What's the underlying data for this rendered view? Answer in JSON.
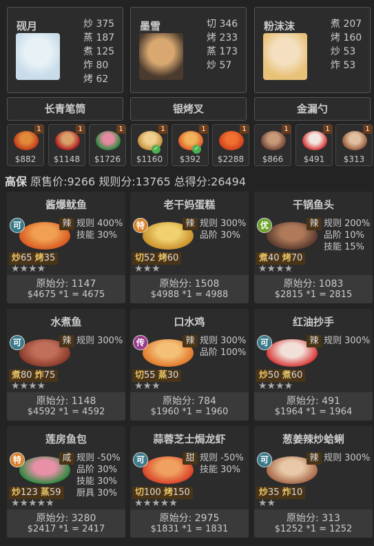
{
  "chefs": [
    {
      "name": "砚月",
      "skills": [
        [
          "炒",
          "375"
        ],
        [
          "蒸",
          "187"
        ],
        [
          "煮",
          "125"
        ],
        [
          "炸",
          "80"
        ],
        [
          "烤",
          "62"
        ]
      ],
      "colors": [
        "#c8dcea",
        "#e8f2f6"
      ]
    },
    {
      "name": "墨雪",
      "skills": [
        [
          "切",
          "346"
        ],
        [
          "烤",
          "233"
        ],
        [
          "蒸",
          "173"
        ],
        [
          "炒",
          "57"
        ]
      ],
      "colors": [
        "#4b3a2e",
        "#d8a870"
      ]
    },
    {
      "name": "粉沫沫",
      "skills": [
        [
          "煮",
          "207"
        ],
        [
          "烤",
          "160"
        ],
        [
          "炒",
          "53"
        ],
        [
          "炸",
          "53"
        ]
      ],
      "colors": [
        "#e8c278",
        "#f4e0c0"
      ]
    }
  ],
  "equipment": [
    "长青笔筒",
    "银烤叉",
    "金漏勺"
  ],
  "items": [
    {
      "badge": "1",
      "price": "$882",
      "check": false,
      "colors": [
        "#c23b1a",
        "#e08a3a"
      ]
    },
    {
      "badge": "1",
      "price": "$1148",
      "check": false,
      "colors": [
        "#b01e1e",
        "#d9a06a"
      ]
    },
    {
      "badge": "1",
      "price": "$1726",
      "check": false,
      "colors": [
        "#2e8a3e",
        "#e48aa2"
      ]
    },
    {
      "badge": "1",
      "price": "$1160",
      "check": true,
      "colors": [
        "#c89240",
        "#f0d090"
      ]
    },
    {
      "badge": "1",
      "price": "$392",
      "check": true,
      "colors": [
        "#e0602a",
        "#f0b25a"
      ]
    },
    {
      "badge": "1",
      "price": "$2288",
      "check": false,
      "colors": [
        "#d2421e",
        "#f07030"
      ]
    },
    {
      "badge": "1",
      "price": "$866",
      "check": false,
      "colors": [
        "#7a4a3a",
        "#c89a7a"
      ]
    },
    {
      "badge": "1",
      "price": "$491",
      "check": false,
      "colors": [
        "#d83a3a",
        "#f2e6e0"
      ]
    },
    {
      "badge": "1",
      "price": "$313",
      "check": false,
      "colors": [
        "#9a6040",
        "#e0c0a0"
      ]
    }
  ],
  "summary": {
    "prefix": "高保",
    "price_label": "原售价:",
    "price": "9266",
    "rule_label": "规则分:",
    "rule": "13765",
    "total_label": "总得分:",
    "total": "26494"
  },
  "cards": [
    {
      "title": "酱爆鱿鱼",
      "rarity": "可",
      "rarity_color": "#3a7a8a",
      "flavor": "辣",
      "bonus": [
        "规则 400%",
        "技能 30%"
      ],
      "skills": [
        [
          "炒",
          "65"
        ],
        [
          "烤",
          "35"
        ]
      ],
      "stars": "★★★★",
      "raw_label": "原始分:",
      "raw": "1147",
      "calc": "$4675 *1 = 4675",
      "colors": [
        "#d85a22",
        "#f0a050"
      ]
    },
    {
      "title": "老干妈蛋糕",
      "rarity": "特",
      "rarity_color": "#d8822a",
      "flavor": "辣",
      "bonus": [
        "规则 300%",
        "品阶 30%"
      ],
      "skills": [
        [
          "切",
          "52"
        ],
        [
          "烤",
          "60"
        ]
      ],
      "stars": "★★★",
      "raw_label": "原始分:",
      "raw": "1508",
      "calc": "$4988 *1 = 4988",
      "colors": [
        "#c8902a",
        "#f0d070"
      ]
    },
    {
      "title": "干锅鱼头",
      "rarity": "优",
      "rarity_color": "#6aa22a",
      "flavor": "辣",
      "bonus": [
        "规则 200%",
        "品阶 10%",
        "技能 15%"
      ],
      "skills": [
        [
          "煮",
          "40"
        ],
        [
          "烤",
          "70"
        ]
      ],
      "stars": "★★★★",
      "raw_label": "原始分:",
      "raw": "1083",
      "calc": "$2815 *1 = 2815",
      "colors": [
        "#5a3a2e",
        "#b07a5a"
      ]
    },
    {
      "title": "水煮鱼",
      "rarity": "可",
      "rarity_color": "#3a7a8a",
      "flavor": "辣",
      "bonus": [
        "规则 300%"
      ],
      "skills": [
        [
          "煮",
          "80"
        ],
        [
          "炸",
          "75"
        ]
      ],
      "stars": "★★★★",
      "raw_label": "原始分:",
      "raw": "1148",
      "calc": "$4592 *1 = 4592",
      "colors": [
        "#8a3a2a",
        "#c0705a"
      ]
    },
    {
      "title": "口水鸡",
      "rarity": "传",
      "rarity_color": "#9a3a8a",
      "flavor": "辣",
      "bonus": [
        "规则 300%",
        "品阶 100%"
      ],
      "skills": [
        [
          "切",
          "55"
        ],
        [
          "蒸",
          "30"
        ]
      ],
      "stars": "★★★",
      "raw_label": "原始分:",
      "raw": "784",
      "calc": "$1960 *1 = 1960",
      "colors": [
        "#e0782a",
        "#f4c078"
      ]
    },
    {
      "title": "红油抄手",
      "rarity": "可",
      "rarity_color": "#3a7a8a",
      "flavor": "辣",
      "bonus": [
        "规则 300%"
      ],
      "skills": [
        [
          "炒",
          "50"
        ],
        [
          "煮",
          "60"
        ]
      ],
      "stars": "★★★★",
      "raw_label": "原始分:",
      "raw": "491",
      "calc": "$1964 *1 = 1964",
      "colors": [
        "#d83a3a",
        "#f2e0d8"
      ]
    },
    {
      "title": "莲房鱼包",
      "rarity": "特",
      "rarity_color": "#d8822a",
      "flavor": "咸",
      "bonus": [
        "规则 -50%",
        "品阶 30%",
        "技能 30%",
        "厨具 30%"
      ],
      "skills": [
        [
          "炒",
          "123"
        ],
        [
          "蒸",
          "59"
        ]
      ],
      "stars": "★★★★★",
      "raw_label": "原始分:",
      "raw": "3280",
      "calc": "$2417 *1 = 2417",
      "colors": [
        "#2e8a3e",
        "#e890a8"
      ]
    },
    {
      "title": "蒜蓉芝士焗龙虾",
      "rarity": "可",
      "rarity_color": "#3a7a8a",
      "flavor": "甜",
      "bonus": [
        "规则 -50%",
        "技能 30%"
      ],
      "skills": [
        [
          "切",
          "100"
        ],
        [
          "烤",
          "150"
        ]
      ],
      "stars": "★★★★★",
      "raw_label": "原始分:",
      "raw": "2975",
      "calc": "$1831 *1 = 1831",
      "colors": [
        "#d8422a",
        "#f0a060"
      ]
    },
    {
      "title": "葱姜辣炒蛤蜊",
      "rarity": "可",
      "rarity_color": "#3a7a8a",
      "flavor": "辣",
      "bonus": [
        "规则 300%"
      ],
      "skills": [
        [
          "炒",
          "35"
        ],
        [
          "炸",
          "10"
        ]
      ],
      "stars": "★★",
      "raw_label": "原始分:",
      "raw": "313",
      "calc": "$1252 *1 = 1252",
      "colors": [
        "#a86a4a",
        "#e8c8a8"
      ]
    }
  ]
}
